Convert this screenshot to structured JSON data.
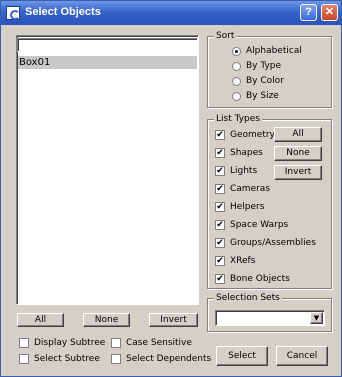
{
  "title": "Select Objects",
  "titlebar": {
    "help": "?",
    "close": "✕"
  },
  "search": {
    "value": ""
  },
  "objects": [
    "Box01"
  ],
  "list_buttons": {
    "all": "All",
    "none": "None",
    "invert": "Invert"
  },
  "options": [
    {
      "label": "Display Subtree",
      "checked": false
    },
    {
      "label": "Case Sensitive",
      "checked": false
    },
    {
      "label": "Select Subtree",
      "checked": false
    },
    {
      "label": "Select Dependents",
      "checked": false
    }
  ],
  "sort": {
    "label": "Sort",
    "options": [
      "Alphabetical",
      "By Type",
      "By Color",
      "By Size"
    ],
    "selected": "Alphabetical"
  },
  "list_types": {
    "label": "List Types",
    "items": [
      {
        "label": "Geometry",
        "checked": true
      },
      {
        "label": "Shapes",
        "checked": true
      },
      {
        "label": "Lights",
        "checked": true
      },
      {
        "label": "Cameras",
        "checked": true
      },
      {
        "label": "Helpers",
        "checked": true
      },
      {
        "label": "Space Warps",
        "checked": true
      },
      {
        "label": "Groups/Assemblies",
        "checked": true
      },
      {
        "label": "XRefs",
        "checked": true
      },
      {
        "label": "Bone Objects",
        "checked": true
      }
    ],
    "buttons": {
      "all": "All",
      "none": "None",
      "invert": "Invert"
    }
  },
  "selection_sets": {
    "label": "Selection Sets",
    "value": "",
    "arrow": "▼"
  },
  "actions": {
    "select": "Select",
    "cancel": "Cancel"
  },
  "check_mark": "✔"
}
